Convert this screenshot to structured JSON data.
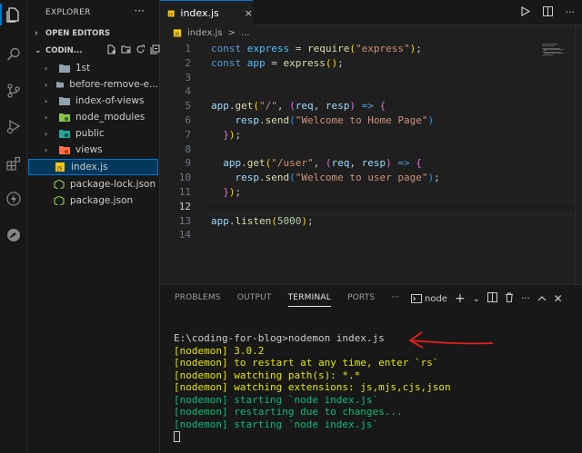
{
  "sidebar": {
    "title": "EXPLORER",
    "more": "···",
    "open_editors": "OPEN EDITORS",
    "folder": "CODIN...",
    "items": [
      {
        "label": "1st",
        "kind": "folder"
      },
      {
        "label": "before-remove-e...",
        "kind": "folder"
      },
      {
        "label": "index-of-views",
        "kind": "folder"
      },
      {
        "label": "node_modules",
        "kind": "folder-node"
      },
      {
        "label": "public",
        "kind": "folder-public"
      },
      {
        "label": "views",
        "kind": "folder-views"
      },
      {
        "label": "index.js",
        "kind": "js"
      },
      {
        "label": "package-lock.json",
        "kind": "json"
      },
      {
        "label": "package.json",
        "kind": "json"
      }
    ]
  },
  "editor": {
    "tab_label": "index.js",
    "tab_close": "×",
    "breadcrumb": {
      "file": "index.js",
      "sep": ">",
      "more": "..."
    },
    "more": "···",
    "line_numbers": [
      "1",
      "2",
      "3",
      "4",
      "5",
      "6",
      "7",
      "8",
      "9",
      "10",
      "11",
      "12",
      "13",
      "14"
    ],
    "lines": [
      [
        [
          "kw",
          "const "
        ],
        [
          "var",
          "express"
        ],
        [
          "pun",
          " = "
        ],
        [
          "fn",
          "require"
        ],
        [
          "br1",
          "("
        ],
        [
          "str",
          "\"express\""
        ],
        [
          "br1",
          ")"
        ],
        [
          "pun",
          ";"
        ]
      ],
      [
        [
          "kw",
          "const "
        ],
        [
          "var",
          "app"
        ],
        [
          "pun",
          " = "
        ],
        [
          "fn",
          "express"
        ],
        [
          "br1",
          "("
        ],
        [
          "br1",
          ")"
        ],
        [
          "pun",
          ";"
        ]
      ],
      [],
      [],
      [
        [
          "prop",
          "app"
        ],
        [
          "pun",
          "."
        ],
        [
          "fn",
          "get"
        ],
        [
          "br1",
          "("
        ],
        [
          "str",
          "\"/\""
        ],
        [
          "pun",
          ", "
        ],
        [
          "br2",
          "("
        ],
        [
          "prop",
          "req"
        ],
        [
          "pun",
          ", "
        ],
        [
          "prop",
          "resp"
        ],
        [
          "br2",
          ")"
        ],
        [
          "pun",
          " "
        ],
        [
          "kw",
          "=>"
        ],
        [
          "pun",
          " "
        ],
        [
          "br2",
          "{"
        ]
      ],
      [
        [
          "pun",
          "    "
        ],
        [
          "prop",
          "resp"
        ],
        [
          "pun",
          "."
        ],
        [
          "fn",
          "send"
        ],
        [
          "br3",
          "("
        ],
        [
          "str",
          "\"Welcome to Home Page\""
        ],
        [
          "br3",
          ")"
        ]
      ],
      [
        [
          "pun",
          "  "
        ],
        [
          "br2",
          "}"
        ],
        [
          "br1",
          ")"
        ],
        [
          "pun",
          ";"
        ]
      ],
      [],
      [
        [
          "pun",
          "  "
        ],
        [
          "prop",
          "app"
        ],
        [
          "pun",
          "."
        ],
        [
          "fn",
          "get"
        ],
        [
          "br1",
          "("
        ],
        [
          "str",
          "\"/user\""
        ],
        [
          "pun",
          ", "
        ],
        [
          "br2",
          "("
        ],
        [
          "prop",
          "req"
        ],
        [
          "pun",
          ", "
        ],
        [
          "prop",
          "resp"
        ],
        [
          "br2",
          ")"
        ],
        [
          "pun",
          " "
        ],
        [
          "kw",
          "=>"
        ],
        [
          "pun",
          " "
        ],
        [
          "br2",
          "{"
        ]
      ],
      [
        [
          "pun",
          "    "
        ],
        [
          "prop",
          "resp"
        ],
        [
          "pun",
          "."
        ],
        [
          "fn",
          "send"
        ],
        [
          "br3",
          "("
        ],
        [
          "str",
          "\"Welcome to user page\""
        ],
        [
          "br3",
          ")"
        ],
        [
          "pun",
          ";"
        ]
      ],
      [
        [
          "pun",
          "  "
        ],
        [
          "br2",
          "}"
        ],
        [
          "br1",
          ")"
        ],
        [
          "pun",
          ";"
        ]
      ],
      [],
      [
        [
          "prop",
          "app"
        ],
        [
          "pun",
          "."
        ],
        [
          "fn",
          "listen"
        ],
        [
          "br1",
          "("
        ],
        [
          "num",
          "5000"
        ],
        [
          "br1",
          ")"
        ],
        [
          "pun",
          ";"
        ]
      ],
      []
    ]
  },
  "panel": {
    "tabs": [
      "PROBLEMS",
      "OUTPUT",
      "TERMINAL",
      "PORTS"
    ],
    "active_tab": "TERMINAL",
    "more": "···",
    "shell": "node",
    "add": "+",
    "dropdown": "⌄",
    "terminal_lines": [
      {
        "text": "E:\\coding-for-blog>nodemon index.js",
        "color": "white"
      },
      {
        "text": "[nodemon] 3.0.2",
        "color": "yellow"
      },
      {
        "text": "[nodemon] to restart at any time, enter `rs`",
        "color": "yellow"
      },
      {
        "text": "[nodemon] watching path(s): *.*",
        "color": "yellow"
      },
      {
        "text": "[nodemon] watching extensions: js,mjs,cjs,json",
        "color": "yellow"
      },
      {
        "text": "[nodemon] starting `node index.js`",
        "color": "green"
      },
      {
        "text": "[nodemon] restarting due to changes...",
        "color": "green"
      },
      {
        "text": "[nodemon] starting `node index.js`",
        "color": "green"
      }
    ]
  },
  "colors": {
    "accent": "#0078d4",
    "annotation_arrow": "#e8211b"
  }
}
